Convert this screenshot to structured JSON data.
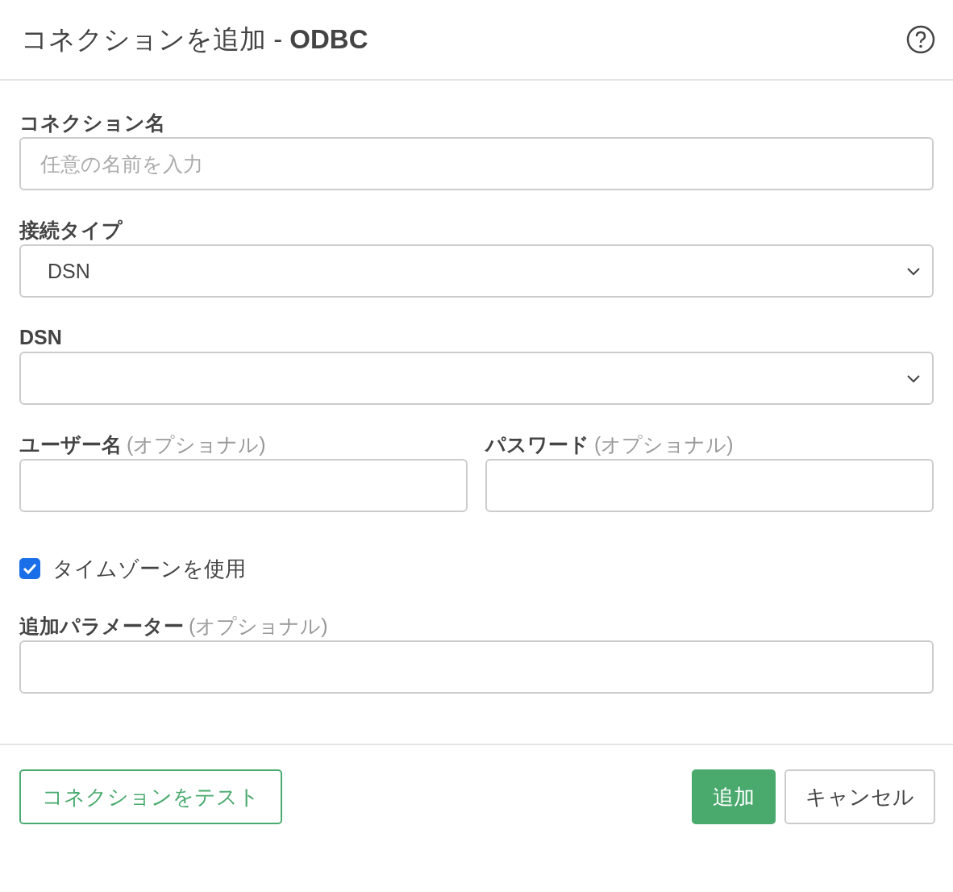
{
  "dialog": {
    "title": "コネクションを追加 - **ODBC**"
  },
  "form": [
    {
      "kind": "text",
      "label": "コネクション名",
      "placeholder": "任意の名前を入力"
    },
    {
      "kind": "select",
      "label": "接続タイプ",
      "value": "DSN"
    },
    {
      "kind": "select",
      "label": "DSN"
    },
    {
      "kind": "row",
      "items": [
        {
          "label": "ユーザー名",
          "note": "(オプショナル)"
        },
        {
          "label": "パスワード",
          "note": "(オプショナル)"
        }
      ]
    },
    {
      "kind": "checkbox",
      "label": "タイムゾーンを使用",
      "checked": true
    },
    {
      "kind": "text",
      "label": "追加パラメーター",
      "note": "(オプショナル)"
    }
  ],
  "footer": {
    "test_button": "コネクションをテスト",
    "buttons": [
      {
        "label": "追加",
        "kind": "primary"
      },
      {
        "label": "キャンセル",
        "kind": "default"
      }
    ]
  }
}
